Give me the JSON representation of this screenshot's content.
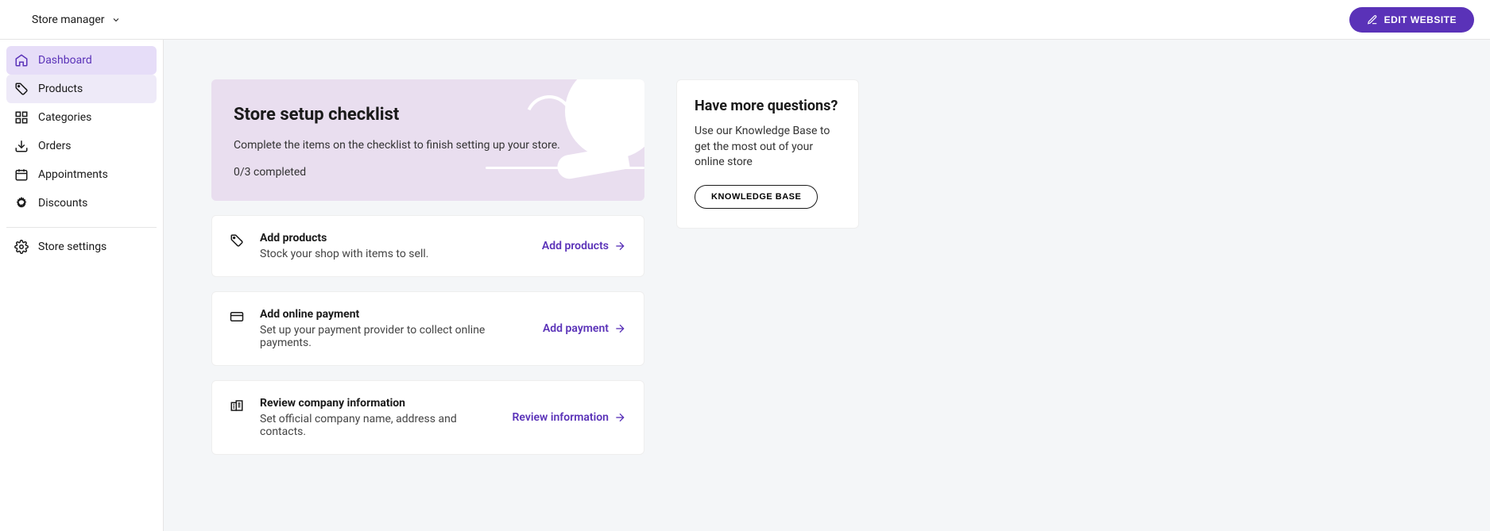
{
  "topbar": {
    "store_switcher_label": "Store manager",
    "edit_website_label": "EDIT WEBSITE"
  },
  "sidebar": {
    "items": [
      {
        "label": "Dashboard",
        "icon": "home-icon",
        "state": "active"
      },
      {
        "label": "Products",
        "icon": "tag-icon",
        "state": "hover"
      },
      {
        "label": "Categories",
        "icon": "grid-icon",
        "state": "normal"
      },
      {
        "label": "Orders",
        "icon": "download-icon",
        "state": "normal"
      },
      {
        "label": "Appointments",
        "icon": "calendar-icon",
        "state": "normal"
      },
      {
        "label": "Discounts",
        "icon": "badge-icon",
        "state": "normal"
      }
    ],
    "settings_label": "Store settings"
  },
  "hero": {
    "title": "Store setup checklist",
    "subtitle": "Complete the items on the checklist to finish setting up your store.",
    "progress": "0/3 completed"
  },
  "checklist": [
    {
      "icon": "tag-icon",
      "title": "Add products",
      "desc": "Stock your shop with items to sell.",
      "action_label": "Add products"
    },
    {
      "icon": "card-icon",
      "title": "Add online payment",
      "desc": "Set up your payment provider to collect online payments.",
      "action_label": "Add payment"
    },
    {
      "icon": "building-icon",
      "title": "Review company information",
      "desc": "Set official company name, address and contacts.",
      "action_label": "Review information"
    }
  ],
  "kb": {
    "title": "Have more questions?",
    "desc": "Use our Knowledge Base to get the most out of your online store",
    "button_label": "KNOWLEDGE BASE"
  },
  "colors": {
    "accent": "#5A32B8",
    "sidebar_active_bg": "#E6DDF8",
    "hero_bg": "#E9DEEF",
    "main_bg": "#F4F6F8"
  }
}
